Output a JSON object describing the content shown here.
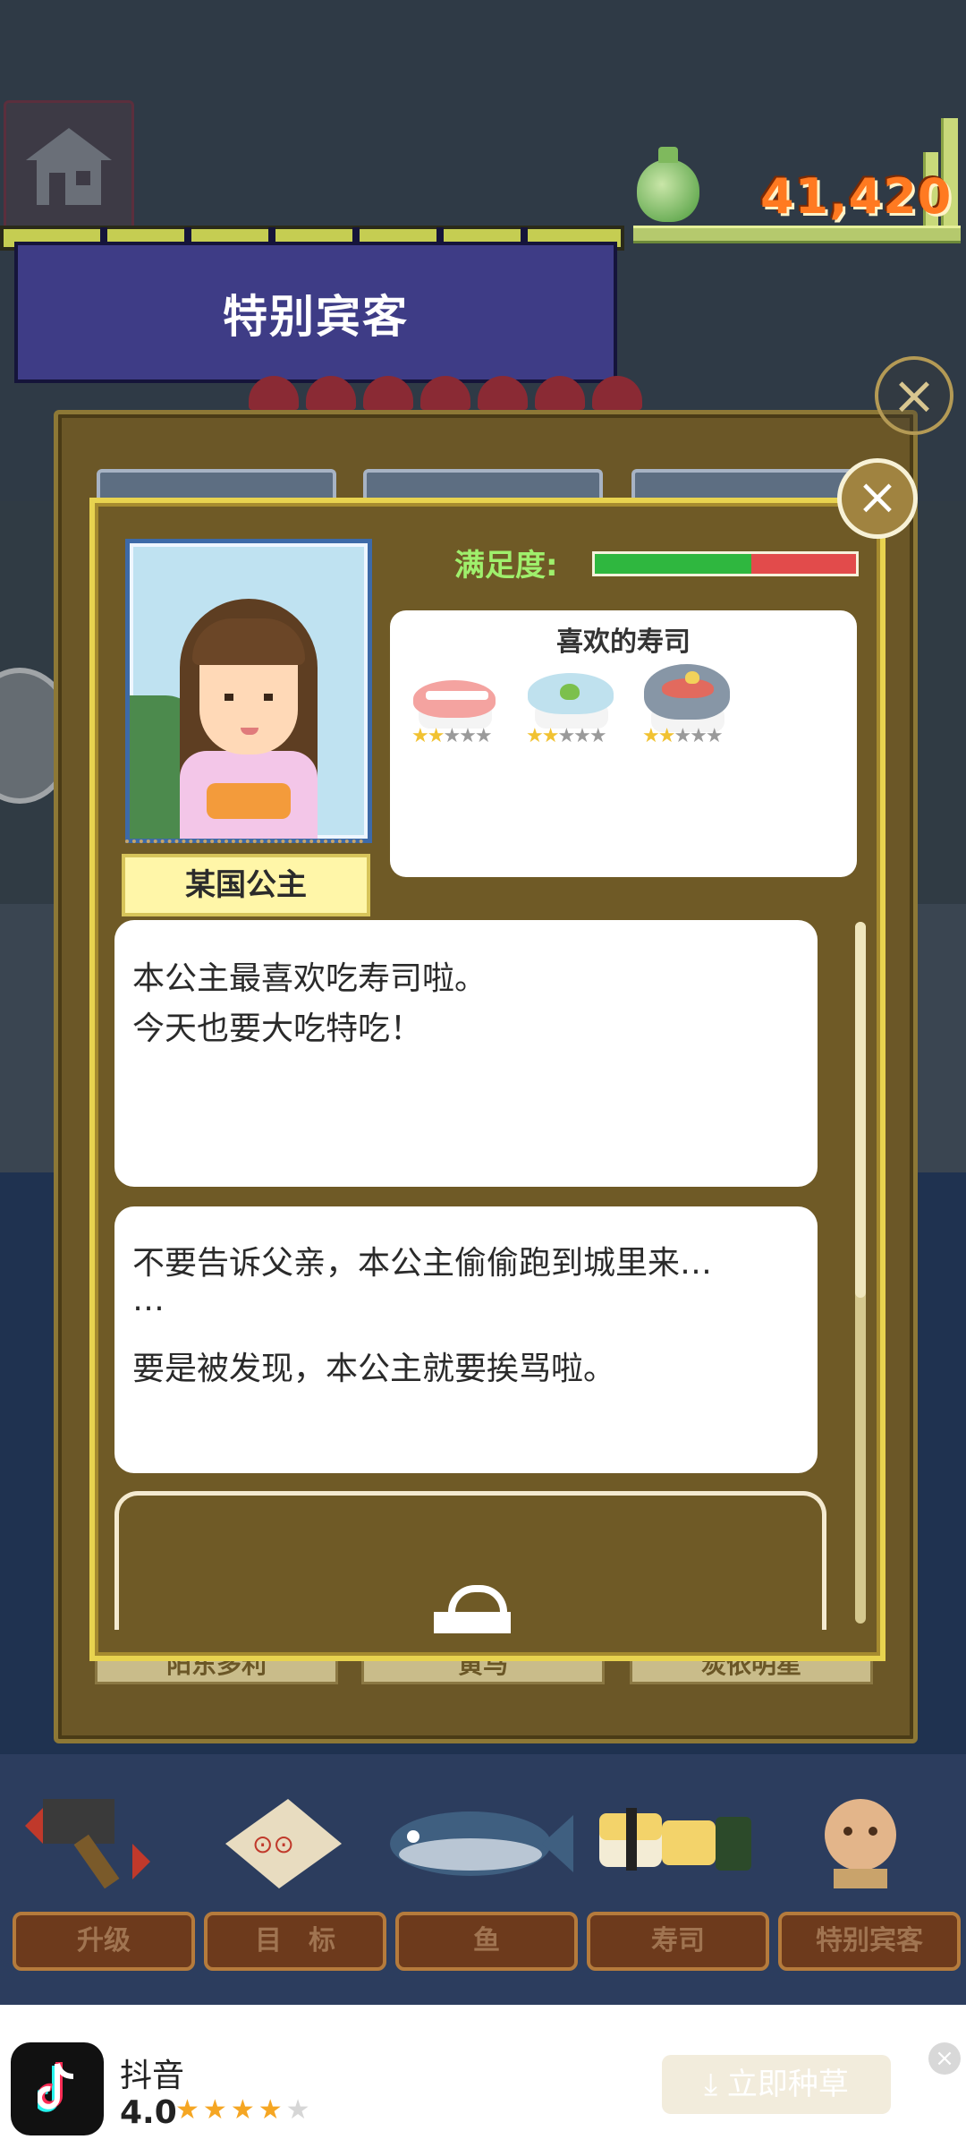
{
  "header": {
    "coins": "41,420",
    "banner_title": "特别宾客"
  },
  "icons": {
    "home": "house-icon",
    "coins": "coin-bag-icon",
    "close": "close-icon",
    "lock": "lock-icon"
  },
  "outer_panel": {
    "bottom_labels": [
      "阳东多利",
      "黄马",
      "炭依明星"
    ]
  },
  "guest": {
    "name": "某国公主",
    "satisfaction_label": "满足度:",
    "satisfaction_fraction": 0.6,
    "favorite_title": "喜欢的寿司",
    "favorites": [
      {
        "icon": "shrimp-sushi-icon",
        "stars": 2,
        "max_stars": 5
      },
      {
        "icon": "sardine-sushi-icon",
        "stars": 2,
        "max_stars": 5
      },
      {
        "icon": "salmon-roe-sushi-icon",
        "stars": 2,
        "max_stars": 5
      }
    ]
  },
  "dialogs": [
    {
      "lines": [
        "本公主最喜欢吃寿司啦。",
        "今天也要大吃特吃！"
      ]
    },
    {
      "lines": [
        "不要告诉父亲，本公主偷偷跑到城里来…",
        "…",
        "要是被发现，本公主就要挨骂啦。"
      ]
    }
  ],
  "bottom_nav": {
    "items": [
      {
        "label": "升级",
        "icon": "hammer-icon"
      },
      {
        "label": "目　标",
        "icon": "target-board-icon"
      },
      {
        "label": "鱼",
        "icon": "fish-icon"
      },
      {
        "label": "寿司",
        "icon": "sushi-icon"
      },
      {
        "label": "特别宾客",
        "icon": "guest-icon"
      }
    ]
  },
  "ad": {
    "app_name": "抖音",
    "rating": "4.0",
    "rating_value": 4,
    "rating_max": 5,
    "button_label": "立即种草",
    "star_color": "#f5a623"
  }
}
